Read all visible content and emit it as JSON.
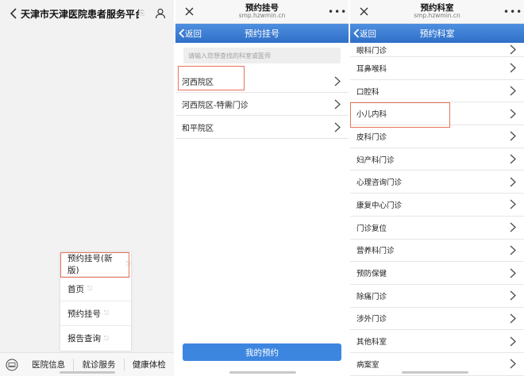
{
  "panel1": {
    "title": "天津市天津医院患者服务平台",
    "menu": [
      {
        "label": "预约挂号(新版)"
      },
      {
        "label": "首页"
      },
      {
        "label": "预约挂号"
      },
      {
        "label": "报告查询"
      }
    ],
    "bottom_tabs": [
      "医院信息",
      "就诊服务",
      "健康体检"
    ]
  },
  "panel2": {
    "header_title": "预约挂号",
    "header_url": "smp.hzwmin.cn",
    "back_label": "返回",
    "nav_title": "预约挂号",
    "search_placeholder": "请输入您想查找的科室或医师",
    "campuses": [
      "河西院区",
      "河西院区-特需门诊",
      "和平院区"
    ],
    "button_label": "我的预约"
  },
  "panel3": {
    "header_title": "预约科室",
    "header_url": "smp.hzwmin.cn",
    "back_label": "返回",
    "nav_title": "预约科室",
    "departments": [
      "眼科门诊",
      "耳鼻喉科",
      "口腔科",
      "小儿内科",
      "皮科门诊",
      "妇产科门诊",
      "心理咨询门诊",
      "康复中心门诊",
      "门诊复位",
      "营养科门诊",
      "预防保健",
      "除痛门诊",
      "涉外门诊",
      "其他科室",
      "病案室"
    ]
  },
  "colors": {
    "nav_blue": "#2f6fc8",
    "button_blue": "#3d86e0",
    "highlight": "#e8735a"
  },
  "icons": {
    "back": "chevron-left-icon",
    "user": "user-icon",
    "close": "close-icon",
    "more": "more-icon",
    "row_arrow": "chevron-right-icon",
    "keyboard": "keyboard-icon"
  }
}
